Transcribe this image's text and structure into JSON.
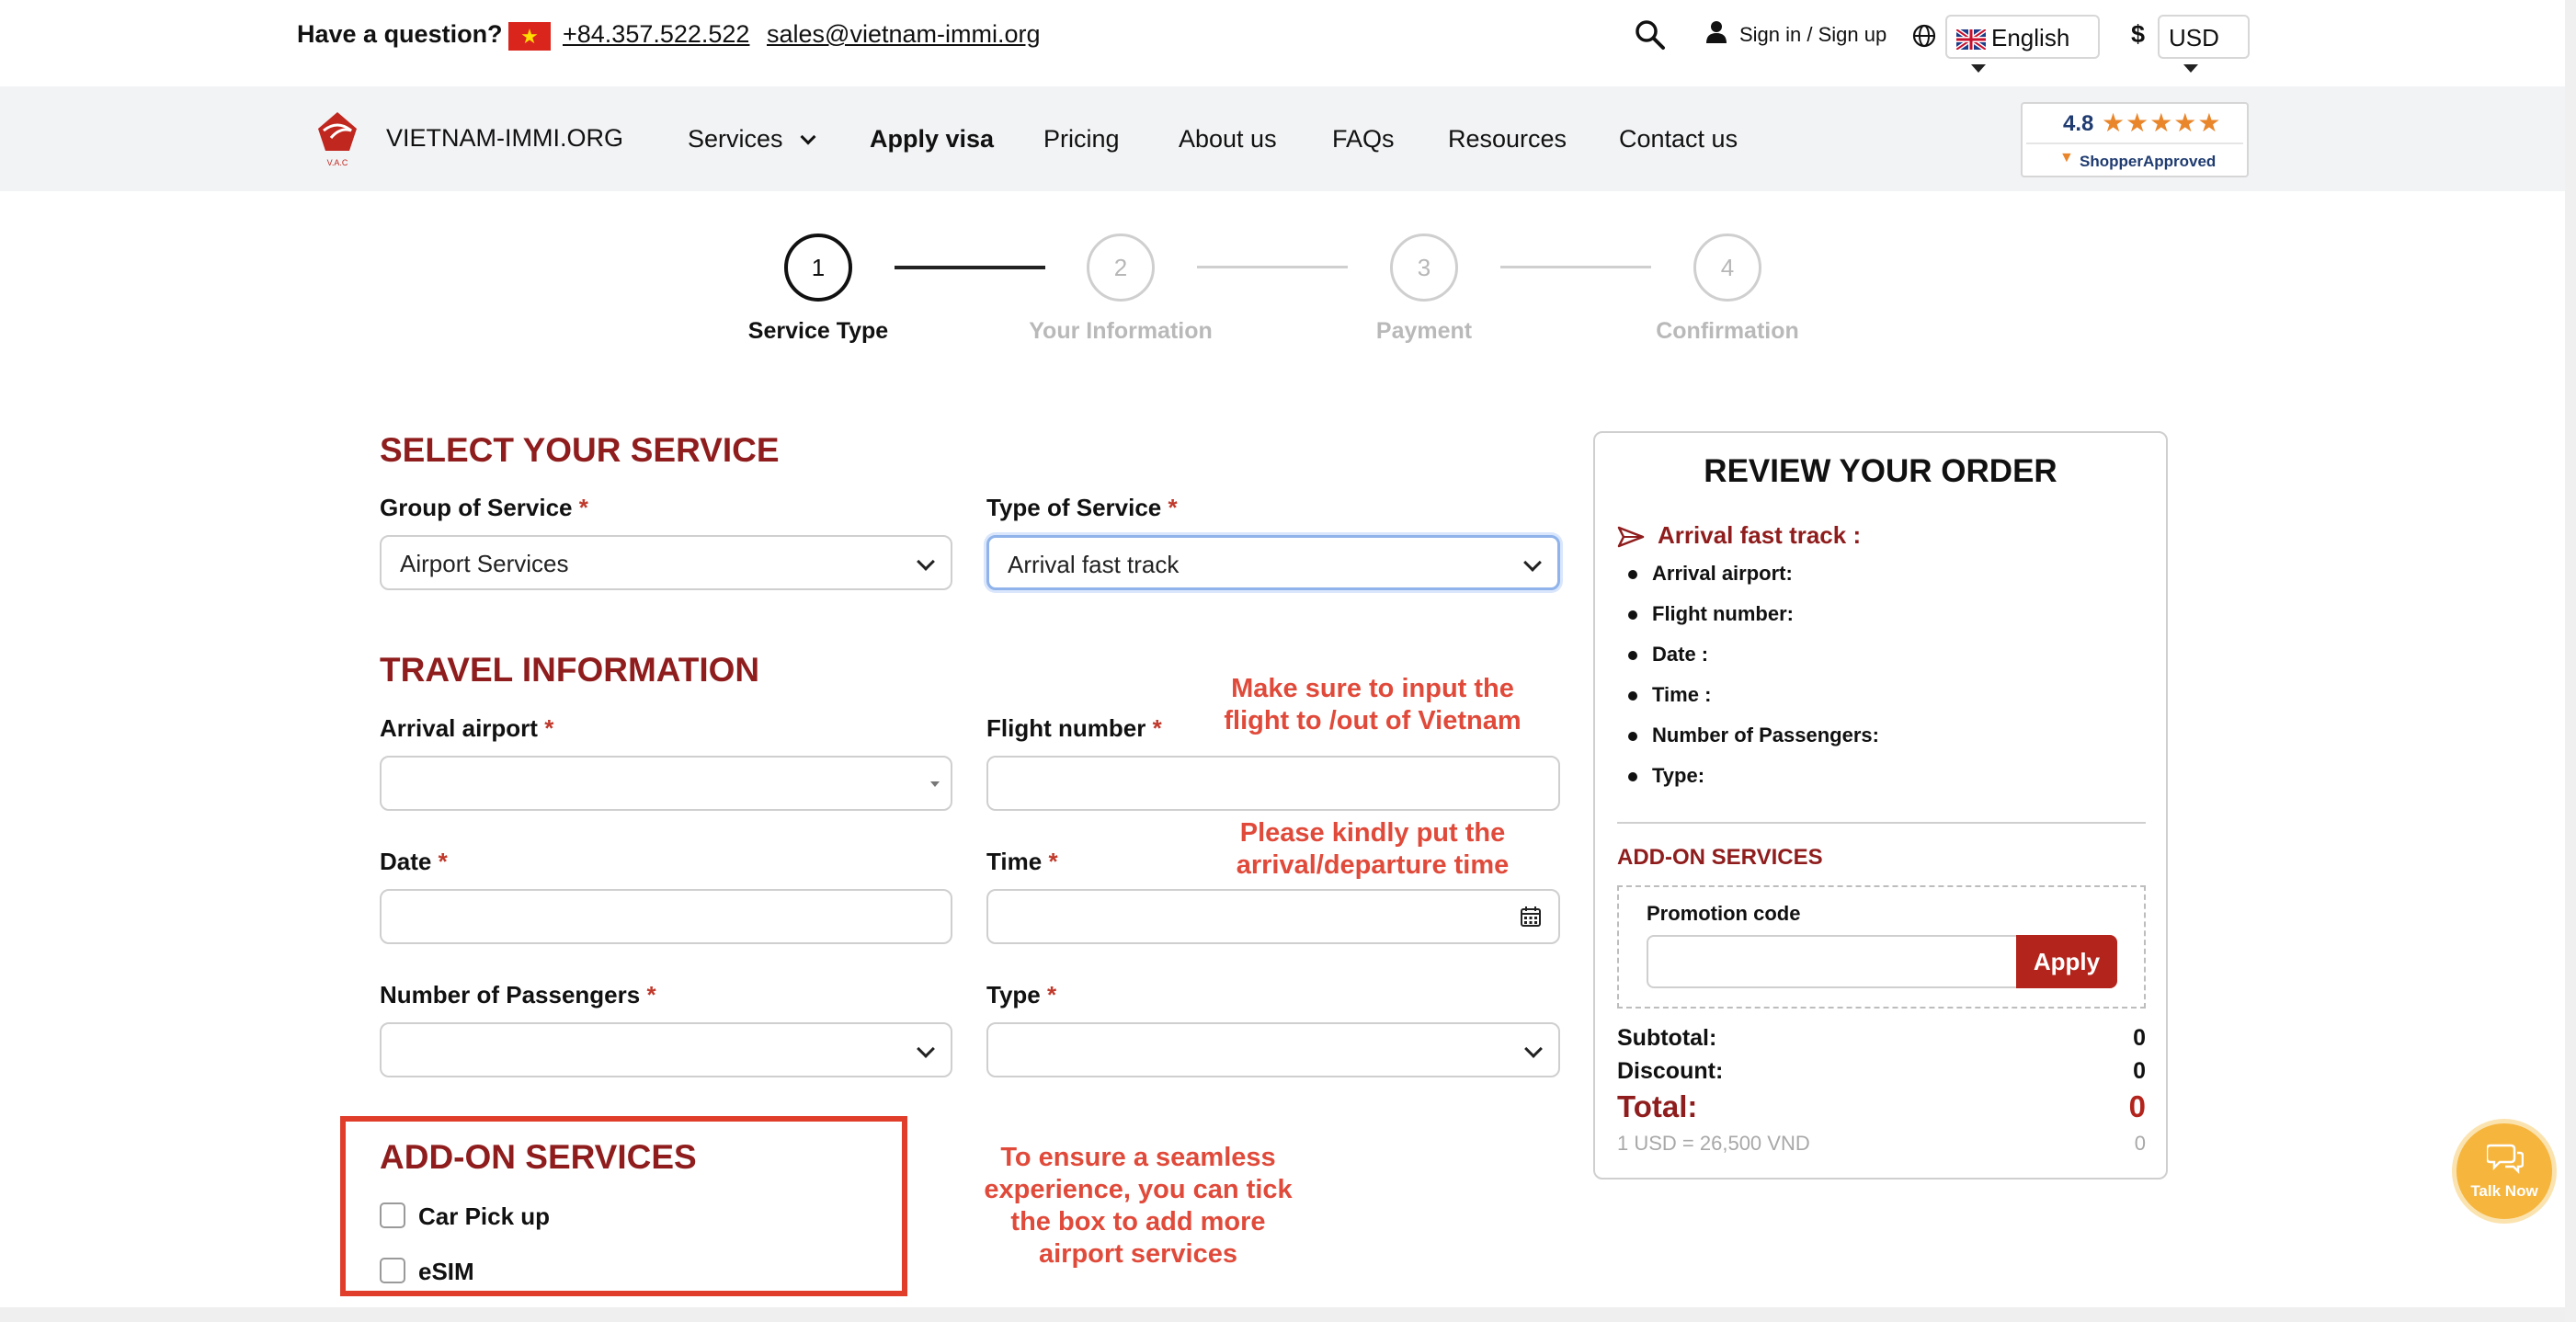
{
  "topbar": {
    "question": "Have a question?",
    "phone": "+84.357.522.522",
    "email": "sales@vietnam-immi.org",
    "signin": "Sign in / Sign up",
    "language": "English",
    "currency_symbol": "$",
    "currency": "USD"
  },
  "nav": {
    "brand": "VIETNAM-IMMI.ORG",
    "items": [
      "Services",
      "Apply visa",
      "Pricing",
      "About us",
      "FAQs",
      "Resources",
      "Contact us"
    ],
    "rating_score": "4.8",
    "rating_stars": "★★★★★",
    "rating_brand": "ShopperApproved"
  },
  "stepper": {
    "steps": [
      {
        "num": "1",
        "label": "Service Type"
      },
      {
        "num": "2",
        "label": "Your Information"
      },
      {
        "num": "3",
        "label": "Payment"
      },
      {
        "num": "4",
        "label": "Confirmation"
      }
    ]
  },
  "service": {
    "title": "SELECT YOUR SERVICE",
    "group_label": "Group of Service",
    "group_value": "Airport Services",
    "type_label": "Type of Service",
    "type_value": "Arrival fast track"
  },
  "travel": {
    "title": "TRAVEL INFORMATION",
    "airport_label": "Arrival airport",
    "flight_label": "Flight number",
    "date_label": "Date",
    "time_label": "Time",
    "passengers_label": "Number of Passengers",
    "type_label": "Type"
  },
  "required_mark": "*",
  "notes": {
    "flight_line1": "Make sure to input the",
    "flight_line2": "flight to /out of Vietnam",
    "time_line1": "Please kindly put the",
    "time_line2": "arrival/departure time",
    "addon_line1": "To ensure a seamless",
    "addon_line2": "experience, you can tick",
    "addon_line3": "the box to add more",
    "addon_line4": "airport services"
  },
  "addons": {
    "title": "ADD-ON SERVICES",
    "items": [
      "Car Pick up",
      "eSIM"
    ]
  },
  "review": {
    "title": "REVIEW YOUR ORDER",
    "service": "Arrival fast track :",
    "fields": [
      "Arrival airport:",
      "Flight number:",
      "Date :",
      "Time :",
      "Number of Passengers:",
      "Type:"
    ],
    "addon_title": "ADD-ON SERVICES",
    "promo_label": "Promotion code",
    "apply": "Apply",
    "subtotal_label": "Subtotal:",
    "subtotal": "0",
    "discount_label": "Discount:",
    "discount": "0",
    "total_label": "Total:",
    "total": "0",
    "rate": "1 USD = 26,500 VND",
    "rate_value": "0"
  },
  "chat": {
    "label": "Talk Now"
  },
  "colors": {
    "accent": "#8f1d1d",
    "apply_button": "#b3241c",
    "note_red": "#e04a3a",
    "chat_orange": "#f6b53d"
  }
}
